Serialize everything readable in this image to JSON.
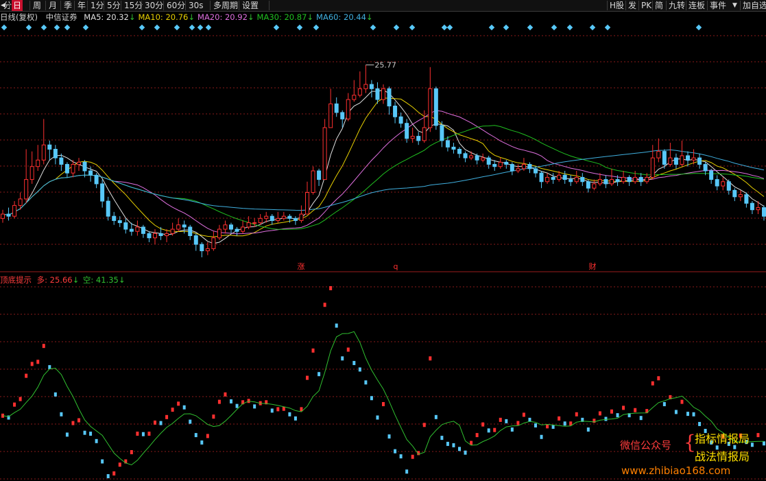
{
  "toolbar": {
    "left_items": [
      {
        "label": "分时",
        "active": false
      },
      {
        "label": "日",
        "active": true
      },
      {
        "label": "周",
        "active": false
      },
      {
        "label": "月",
        "active": false
      },
      {
        "label": "季",
        "active": false
      },
      {
        "label": "年",
        "active": false
      },
      {
        "label": "1分",
        "active": false
      },
      {
        "label": "5分",
        "active": false
      },
      {
        "label": "15分",
        "active": false
      },
      {
        "label": "30分",
        "active": false
      },
      {
        "label": "60分",
        "active": false
      },
      {
        "label": "30s",
        "active": false
      },
      {
        "label": "多周期",
        "active": false
      },
      {
        "label": "设置",
        "active": false
      }
    ],
    "right_items": [
      "H股",
      "发",
      "PK",
      "简",
      "九转",
      "连板",
      "事件",
      "加自选"
    ]
  },
  "main_info": {
    "period": "日线(复权)",
    "name": "中信证券",
    "ma": [
      {
        "label": "MA5: 20.32",
        "arrow": "↓",
        "color": "#e0e0e0"
      },
      {
        "label": "MA10: 20.76",
        "arrow": "↓",
        "color": "#e8d000"
      },
      {
        "label": "MA20: 20.92",
        "arrow": "↓",
        "color": "#e070e0"
      },
      {
        "label": "MA30: 20.87",
        "arrow": "↓",
        "color": "#20c020"
      },
      {
        "label": "MA60: 20.44",
        "arrow": "↓",
        "color": "#40b0e0"
      }
    ]
  },
  "sub_info": {
    "name": "顶底提示",
    "long_label": "多: 25.66",
    "long_arrow": "↓",
    "short_label": "空: 41.35",
    "short_arrow": "↓"
  },
  "annotations": {
    "high_price": "25.77",
    "event_marks": [
      "涨",
      "q",
      "财"
    ]
  },
  "watermark": {
    "line1": "微信公众号",
    "line2a": "指标情报局",
    "line2b": "战法情报局",
    "url": "www.zhibiao168.com"
  },
  "colors": {
    "up": "#ff3030",
    "down": "#58c8f8",
    "ma5": "#e0e0e0",
    "ma10": "#e8d000",
    "ma20": "#e070e0",
    "ma30": "#20c020",
    "ma60": "#40b0e0",
    "signal_line": "#30c030",
    "grid": "#8b1a1a",
    "watermark_red": "#ff3c3c",
    "watermark_yellow": "#ffe000",
    "watermark_orange": "#ff8000"
  },
  "chart_data": {
    "type": "candlestick",
    "price_range": [
      17.0,
      27.0
    ],
    "high_price_label": 25.77,
    "candles": [
      [
        18.8,
        19.0,
        19.2,
        18.6
      ],
      [
        19.0,
        18.9,
        19.3,
        18.7
      ],
      [
        18.9,
        19.4,
        19.6,
        18.8
      ],
      [
        19.4,
        19.7,
        20.0,
        19.2
      ],
      [
        19.7,
        20.6,
        22.0,
        19.5
      ],
      [
        20.6,
        21.2,
        21.9,
        20.4
      ],
      [
        21.2,
        21.5,
        22.2,
        21.0
      ],
      [
        21.5,
        22.2,
        23.4,
        21.3
      ],
      [
        22.2,
        22.0,
        22.4,
        21.5
      ],
      [
        22.0,
        21.6,
        22.2,
        21.3
      ],
      [
        21.6,
        21.3,
        21.8,
        21.0
      ],
      [
        21.3,
        20.9,
        21.4,
        20.7
      ],
      [
        20.9,
        21.3,
        21.5,
        20.7
      ],
      [
        21.3,
        21.4,
        21.6,
        21.0
      ],
      [
        21.4,
        21.0,
        21.5,
        20.7
      ],
      [
        21.0,
        20.8,
        21.2,
        20.5
      ],
      [
        20.8,
        20.4,
        20.9,
        20.2
      ],
      [
        20.4,
        19.6,
        20.6,
        19.3
      ],
      [
        19.6,
        18.9,
        19.8,
        18.7
      ],
      [
        18.9,
        18.7,
        19.1,
        18.5
      ],
      [
        18.7,
        18.6,
        18.9,
        18.4
      ],
      [
        18.6,
        18.3,
        18.8,
        18.1
      ],
      [
        18.3,
        18.2,
        18.6,
        18.0
      ],
      [
        18.2,
        18.4,
        18.7,
        18.0
      ],
      [
        18.4,
        18.1,
        18.5,
        17.9
      ],
      [
        18.1,
        17.9,
        18.2,
        17.7
      ],
      [
        17.9,
        18.1,
        18.3,
        17.6
      ],
      [
        18.1,
        18.0,
        18.4,
        17.8
      ],
      [
        18.0,
        18.1,
        18.3,
        17.7
      ],
      [
        18.1,
        18.3,
        18.6,
        18.0
      ],
      [
        18.3,
        18.5,
        18.8,
        18.2
      ],
      [
        18.5,
        18.4,
        18.7,
        18.1
      ],
      [
        18.4,
        18.0,
        18.5,
        17.8
      ],
      [
        18.0,
        17.6,
        18.1,
        17.3
      ],
      [
        17.6,
        17.3,
        17.7,
        17.0
      ],
      [
        17.3,
        17.4,
        17.7,
        17.1
      ],
      [
        17.4,
        17.9,
        18.2,
        17.3
      ],
      [
        17.9,
        18.3,
        18.5,
        17.8
      ],
      [
        18.3,
        18.5,
        18.7,
        18.1
      ],
      [
        18.5,
        18.3,
        18.6,
        18.1
      ],
      [
        18.3,
        18.2,
        18.4,
        18.0
      ],
      [
        18.2,
        18.4,
        18.7,
        18.1
      ],
      [
        18.4,
        18.6,
        18.9,
        18.3
      ],
      [
        18.6,
        18.6,
        18.8,
        18.4
      ],
      [
        18.6,
        18.8,
        19.0,
        18.5
      ],
      [
        18.8,
        18.9,
        19.1,
        18.6
      ],
      [
        18.9,
        18.7,
        19.0,
        18.5
      ],
      [
        18.7,
        18.8,
        19.1,
        18.6
      ],
      [
        18.8,
        18.9,
        19.1,
        18.7
      ],
      [
        18.9,
        18.8,
        19.0,
        18.6
      ],
      [
        18.8,
        18.7,
        18.9,
        18.5
      ],
      [
        18.7,
        19.0,
        19.4,
        18.6
      ],
      [
        19.0,
        20.0,
        20.5,
        19.0
      ],
      [
        20.0,
        21.0,
        21.2,
        19.9
      ],
      [
        21.0,
        20.6,
        21.1,
        20.3
      ],
      [
        20.6,
        23.0,
        23.4,
        20.6
      ],
      [
        23.0,
        24.1,
        24.8,
        23.0
      ],
      [
        24.1,
        23.7,
        24.4,
        23.5
      ],
      [
        23.7,
        23.4,
        23.8,
        23.0
      ],
      [
        23.4,
        24.3,
        24.6,
        23.3
      ],
      [
        24.3,
        24.5,
        25.2,
        24.2
      ],
      [
        24.5,
        24.8,
        25.6,
        24.4
      ],
      [
        24.8,
        25.0,
        25.9,
        24.6
      ],
      [
        25.0,
        24.8,
        25.2,
        24.4
      ],
      [
        24.8,
        24.3,
        25.1,
        24.1
      ],
      [
        24.3,
        24.8,
        25.0,
        24.1
      ],
      [
        24.8,
        24.0,
        24.9,
        23.6
      ],
      [
        24.0,
        23.5,
        24.2,
        23.2
      ],
      [
        23.5,
        23.2,
        23.7,
        23.0
      ],
      [
        23.2,
        22.5,
        23.4,
        22.3
      ],
      [
        22.5,
        22.6,
        23.0,
        22.3
      ],
      [
        22.6,
        22.4,
        22.8,
        22.2
      ],
      [
        22.4,
        23.0,
        23.8,
        22.3
      ],
      [
        23.0,
        24.8,
        25.8,
        22.8
      ],
      [
        24.8,
        23.1,
        24.9,
        22.9
      ],
      [
        23.1,
        22.4,
        23.3,
        22.1
      ],
      [
        22.4,
        22.1,
        22.6,
        21.9
      ],
      [
        22.1,
        22.0,
        22.3,
        21.8
      ],
      [
        22.0,
        21.8,
        22.1,
        21.6
      ],
      [
        21.8,
        21.6,
        21.9,
        21.4
      ],
      [
        21.6,
        21.7,
        21.9,
        21.5
      ],
      [
        21.7,
        21.5,
        21.8,
        21.3
      ],
      [
        21.5,
        21.6,
        21.8,
        21.4
      ],
      [
        21.6,
        21.3,
        21.7,
        21.1
      ],
      [
        21.3,
        21.2,
        21.5,
        21.0
      ],
      [
        21.2,
        21.4,
        21.6,
        21.1
      ],
      [
        21.4,
        21.3,
        21.5,
        21.1
      ],
      [
        21.3,
        21.0,
        21.4,
        20.8
      ],
      [
        21.0,
        21.1,
        21.3,
        20.9
      ],
      [
        21.1,
        21.3,
        21.6,
        21.0
      ],
      [
        21.3,
        21.1,
        21.4,
        20.9
      ],
      [
        21.1,
        20.9,
        21.2,
        20.7
      ],
      [
        20.9,
        20.5,
        21.0,
        20.2
      ],
      [
        20.5,
        20.7,
        20.9,
        20.4
      ],
      [
        20.7,
        20.6,
        20.9,
        20.4
      ],
      [
        20.6,
        20.8,
        21.0,
        20.5
      ],
      [
        20.8,
        20.6,
        21.0,
        20.4
      ],
      [
        20.6,
        20.5,
        20.8,
        20.3
      ],
      [
        20.5,
        20.7,
        21.0,
        20.4
      ],
      [
        20.7,
        20.5,
        20.9,
        20.3
      ],
      [
        20.5,
        20.2,
        20.6,
        20.0
      ],
      [
        20.2,
        20.4,
        20.6,
        20.1
      ],
      [
        20.4,
        20.6,
        20.9,
        20.3
      ],
      [
        20.6,
        20.4,
        20.8,
        20.2
      ],
      [
        20.4,
        20.6,
        21.1,
        20.3
      ],
      [
        20.6,
        20.5,
        20.8,
        20.3
      ],
      [
        20.5,
        20.7,
        21.0,
        20.4
      ],
      [
        20.7,
        20.5,
        20.8,
        20.3
      ],
      [
        20.5,
        20.7,
        21.0,
        20.4
      ],
      [
        20.7,
        20.5,
        20.9,
        20.3
      ],
      [
        20.5,
        20.7,
        20.9,
        20.4
      ],
      [
        20.7,
        21.6,
        22.2,
        20.6
      ],
      [
        21.6,
        21.9,
        22.5,
        21.4
      ],
      [
        21.9,
        21.3,
        22.0,
        21.1
      ],
      [
        21.3,
        21.6,
        22.3,
        21.2
      ],
      [
        21.6,
        21.3,
        21.8,
        21.1
      ],
      [
        21.3,
        21.7,
        22.4,
        21.2
      ],
      [
        21.7,
        21.5,
        21.9,
        21.2
      ],
      [
        21.5,
        21.6,
        22.0,
        21.3
      ],
      [
        21.6,
        21.3,
        21.8,
        21.1
      ],
      [
        21.3,
        21.0,
        21.4,
        20.8
      ],
      [
        21.0,
        20.6,
        21.1,
        20.4
      ],
      [
        20.6,
        20.3,
        20.8,
        20.1
      ],
      [
        20.3,
        20.5,
        20.7,
        20.1
      ],
      [
        20.5,
        20.1,
        20.6,
        19.9
      ],
      [
        20.1,
        19.8,
        20.2,
        19.6
      ],
      [
        19.8,
        19.9,
        20.1,
        19.6
      ],
      [
        19.9,
        19.5,
        20.0,
        19.3
      ],
      [
        19.5,
        19.2,
        19.6,
        19.0
      ],
      [
        19.2,
        19.3,
        19.6,
        19.0
      ],
      [
        19.3,
        18.9,
        19.4,
        18.7
      ]
    ]
  }
}
